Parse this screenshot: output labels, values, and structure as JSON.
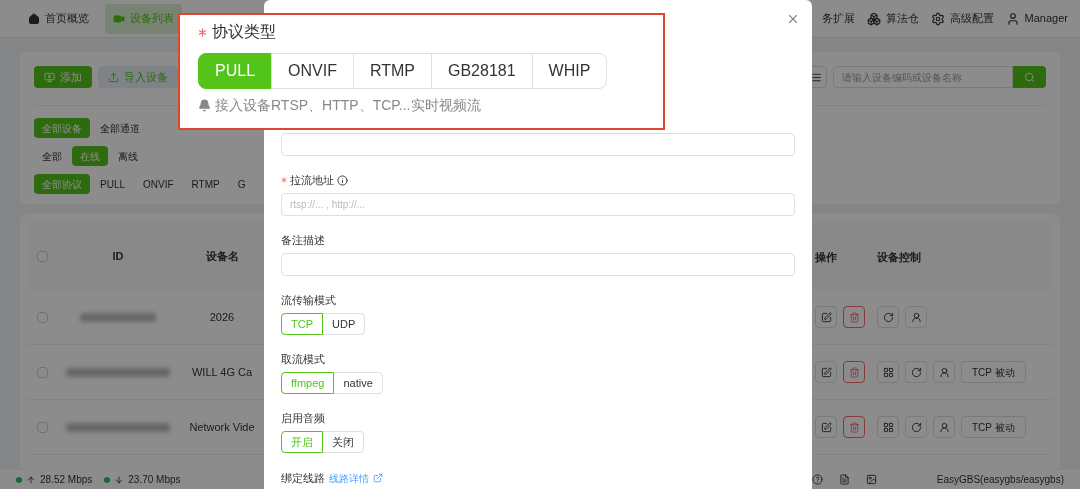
{
  "nav": {
    "left": [
      {
        "label": "首页概览",
        "selected": false
      },
      {
        "label": "设备列表",
        "selected": true
      }
    ],
    "right": [
      {
        "label": "务扩展"
      },
      {
        "label": "算法仓"
      },
      {
        "label": "高级配置"
      },
      {
        "label": "Manager"
      }
    ]
  },
  "toolbar": {
    "buttons": [
      {
        "label": "添加",
        "kind": "primary"
      },
      {
        "label": "导入设备",
        "kind": "secondary"
      }
    ],
    "search": {
      "placeholder": "请输入设备编码或设备名称"
    }
  },
  "filters": [
    [
      {
        "label": "全部设备",
        "selected": true
      },
      {
        "label": "全部通道",
        "selected": false
      }
    ],
    [
      {
        "label": "全部",
        "selected": false
      },
      {
        "label": "在线",
        "selected": true
      },
      {
        "label": "离线",
        "selected": false
      }
    ],
    [
      {
        "label": "全部协议",
        "selected": true
      },
      {
        "label": "PULL",
        "selected": false
      },
      {
        "label": "ONVIF",
        "selected": false
      },
      {
        "label": "RTMP",
        "selected": false
      },
      {
        "label": "G",
        "selected": false
      }
    ]
  ],
  "table": {
    "all_checked": false,
    "columns_left": [
      "ID",
      "设备名"
    ],
    "columns_right": [
      "操作",
      "设备控制"
    ],
    "rows": [
      {
        "checked": false,
        "name": "2026",
        "controls": [
          {
            "kind": "refresh"
          },
          {
            "kind": "person"
          }
        ]
      },
      {
        "checked": false,
        "name": "WILL 4G Ca",
        "controls": [
          {
            "kind": "grid"
          },
          {
            "kind": "refresh"
          },
          {
            "kind": "person"
          },
          {
            "kind": "text",
            "label": "TCP 被动"
          }
        ]
      },
      {
        "checked": false,
        "name": "Network Vide",
        "controls": [
          {
            "kind": "grid"
          },
          {
            "kind": "refresh"
          },
          {
            "kind": "person"
          },
          {
            "kind": "text",
            "label": "TCP 被动"
          }
        ]
      }
    ]
  },
  "status_bar": {
    "upload": "28.52 Mbps",
    "download": "23.70 Mbps",
    "account": "EasyGBS(easygbs/easygbs)"
  },
  "dialog": {
    "fields": [
      {
        "kind": "input"
      },
      {
        "kind": "input",
        "label": "拉流地址",
        "required": true,
        "info": true,
        "placeholder": "rtsp://... , http://..."
      },
      {
        "kind": "input",
        "label": "备注描述"
      },
      {
        "kind": "segmented",
        "label": "流传输模式",
        "options": [
          {
            "label": "TCP",
            "selected": true
          },
          {
            "label": "UDP",
            "selected": false
          }
        ]
      },
      {
        "kind": "segmented",
        "label": "取流模式",
        "options": [
          {
            "label": "ffmpeg",
            "selected": true
          },
          {
            "label": "native",
            "selected": false
          }
        ]
      },
      {
        "kind": "segmented",
        "label": "启用音频",
        "options": [
          {
            "label": "开启",
            "selected": true
          },
          {
            "label": "关闭",
            "selected": false
          }
        ]
      },
      {
        "kind": "link",
        "label": "绑定线路",
        "link": "线路详情"
      }
    ]
  },
  "callout": {
    "label": "协议类型",
    "required": true,
    "options": [
      {
        "label": "PULL",
        "selected": true
      },
      {
        "label": "ONVIF",
        "selected": false
      },
      {
        "label": "RTMP",
        "selected": false
      },
      {
        "label": "GB28181",
        "selected": false
      },
      {
        "label": "WHIP",
        "selected": false
      }
    ],
    "hint": "接入设备RTSP、HTTP、TCP...实时视频流"
  }
}
